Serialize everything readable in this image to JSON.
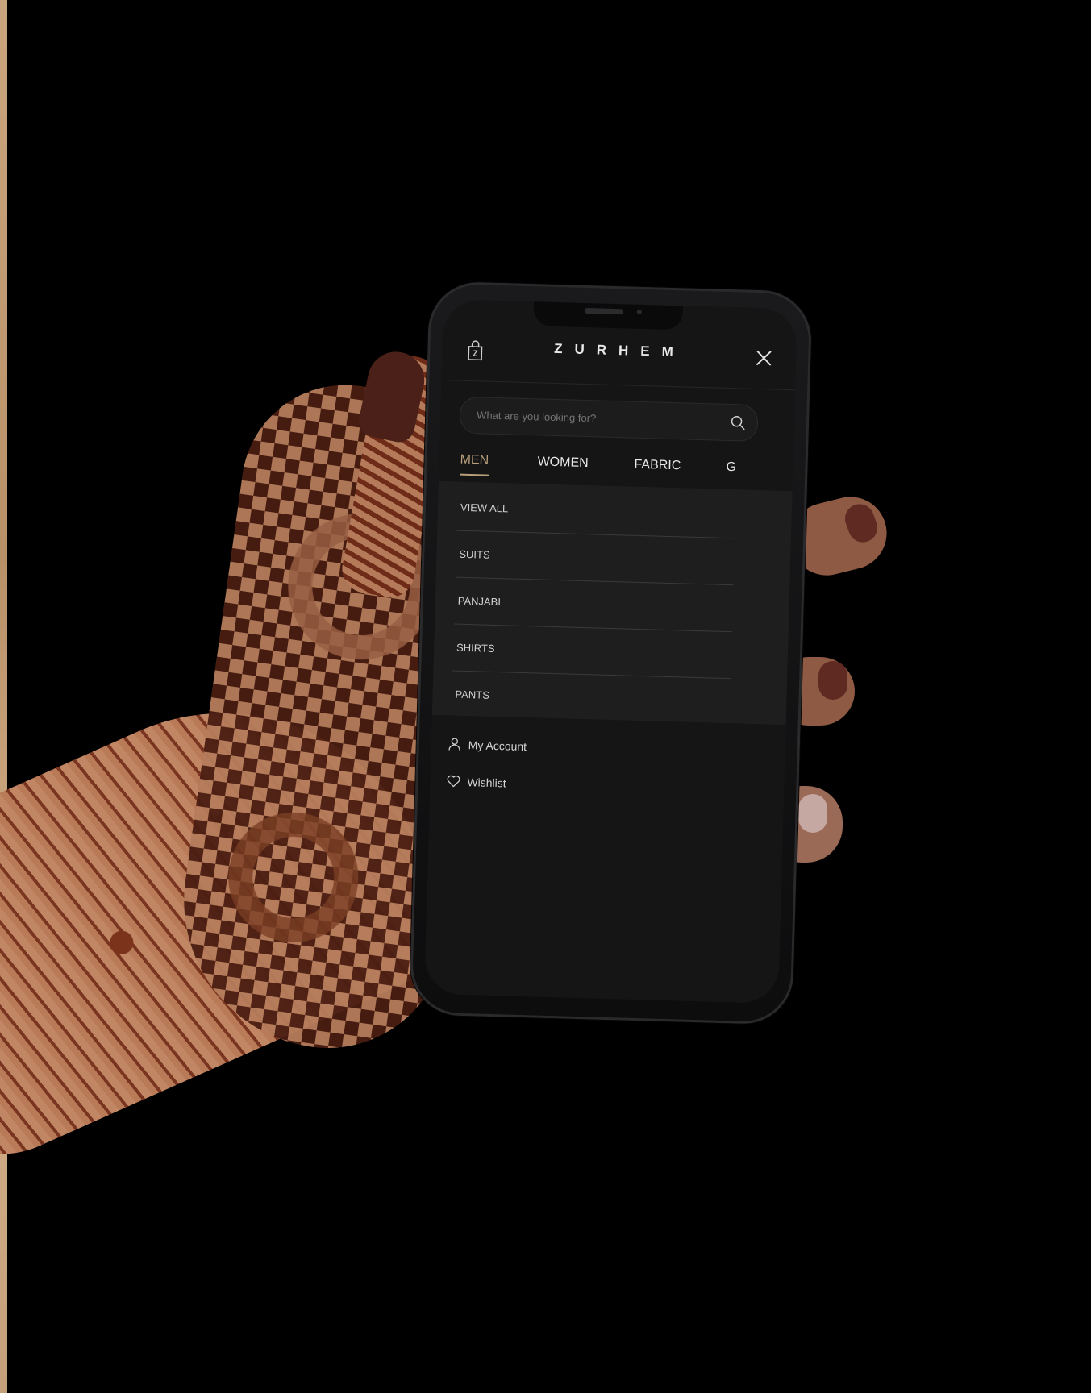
{
  "app": {
    "brand": "ZURHEM"
  },
  "header": {
    "bag_icon": "shopping-bag-icon",
    "close_icon": "close-icon"
  },
  "search": {
    "placeholder": "What are you looking for?",
    "icon": "search-icon"
  },
  "tabs": [
    {
      "label": "MEN",
      "active": true
    },
    {
      "label": "WOMEN",
      "active": false
    },
    {
      "label": "FABRIC",
      "active": false
    },
    {
      "label": "G",
      "active": false
    }
  ],
  "submenu": {
    "items": [
      {
        "label": "VIEW ALL"
      },
      {
        "label": "SUITS"
      },
      {
        "label": "PANJABI"
      },
      {
        "label": "SHIRTS"
      },
      {
        "label": "PANTS"
      }
    ]
  },
  "account": {
    "my_account": {
      "label": "My Account",
      "icon": "user-icon"
    },
    "wishlist": {
      "label": "Wishlist",
      "icon": "heart-icon"
    }
  },
  "colors": {
    "accent": "#b9a07a",
    "screen_bg": "#151516",
    "submenu_bg": "#1e1e1f"
  }
}
